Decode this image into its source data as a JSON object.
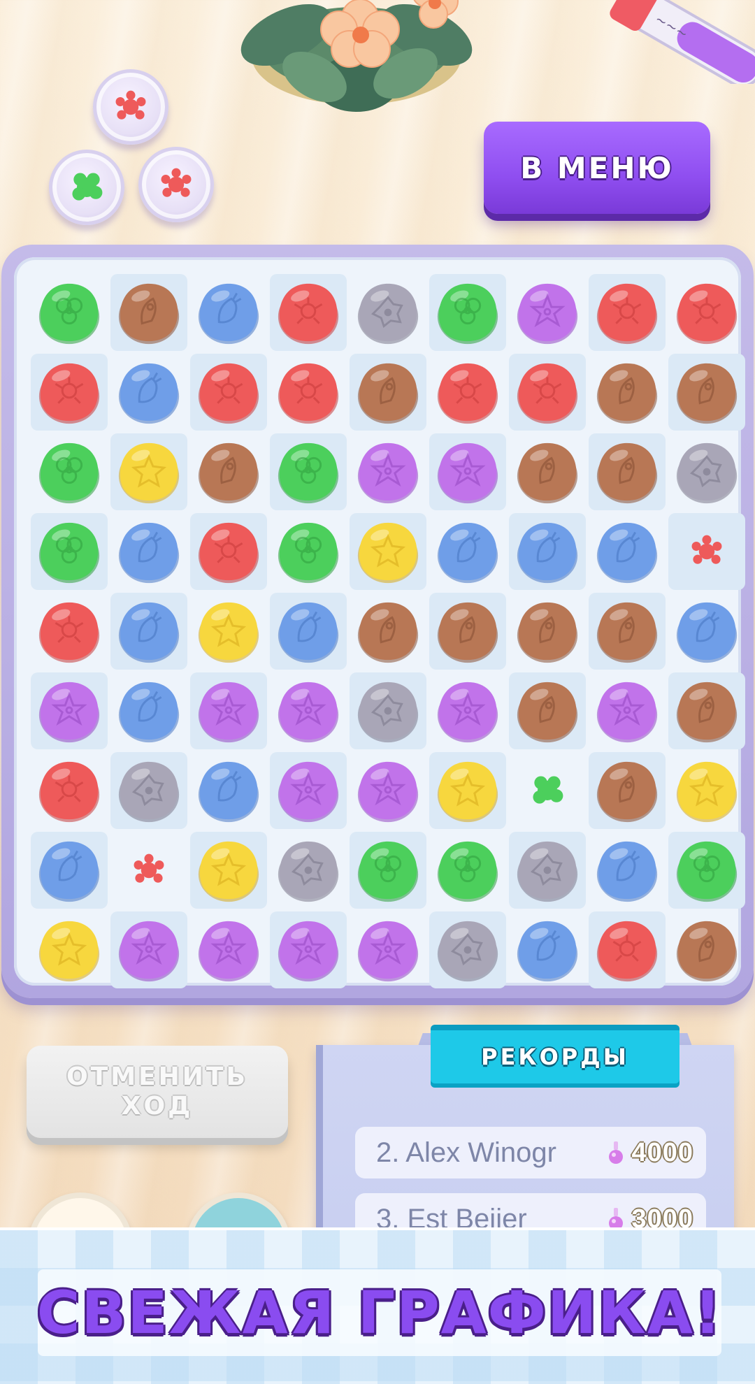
{
  "header": {
    "menu_button_label": "В МЕНЮ"
  },
  "decor": {
    "dishes": [
      {
        "germ": "red"
      },
      {
        "germ": "green"
      },
      {
        "germ": "red"
      }
    ]
  },
  "colors": {
    "green": "#4ccf5c",
    "brown": "#b87755",
    "blue": "#6f9ee8",
    "red": "#ee5a5a",
    "gray": "#a9a6b7",
    "purple": "#c173ea",
    "yellow": "#f7d73e",
    "accent_purple": "#8f4ef0",
    "records_cyan": "#1ec9e8"
  },
  "board": {
    "rows": [
      [
        "green",
        "brown",
        "blue",
        "red",
        "gray",
        "green",
        "purple",
        "red",
        "red"
      ],
      [
        "red",
        "blue",
        "red",
        "red",
        "brown",
        "red",
        "red",
        "brown",
        "brown"
      ],
      [
        "green",
        "yellow",
        "brown",
        "green",
        "purple",
        "purple",
        "brown",
        "brown",
        "gray"
      ],
      [
        "green",
        "blue",
        "red",
        "green",
        "yellow",
        "blue",
        "blue",
        "blue",
        "small-red"
      ],
      [
        "red",
        "blue",
        "yellow",
        "blue",
        "brown",
        "brown",
        "brown",
        "brown",
        "blue"
      ],
      [
        "purple",
        "blue",
        "purple",
        "purple",
        "gray",
        "purple",
        "brown",
        "purple",
        "brown"
      ],
      [
        "red",
        "gray",
        "blue",
        "purple",
        "purple",
        "yellow",
        "small-green",
        "brown",
        "yellow"
      ],
      [
        "blue",
        "small-red",
        "yellow",
        "gray",
        "green",
        "green",
        "gray",
        "blue",
        "green"
      ],
      [
        "yellow",
        "purple",
        "purple",
        "purple",
        "purple",
        "gray",
        "blue",
        "red",
        "brown"
      ]
    ]
  },
  "controls": {
    "undo_line1": "ОТМЕНИТЬ",
    "undo_line2": "ХОД"
  },
  "records": {
    "title": "РЕКОРДЫ",
    "entries": [
      {
        "name": "2. Alex Winogr",
        "score": "4000"
      },
      {
        "name": "3. Est Beijer",
        "score": "3000"
      }
    ]
  },
  "promo": {
    "text": "СВЕЖАЯ ГРАФИКА!"
  }
}
